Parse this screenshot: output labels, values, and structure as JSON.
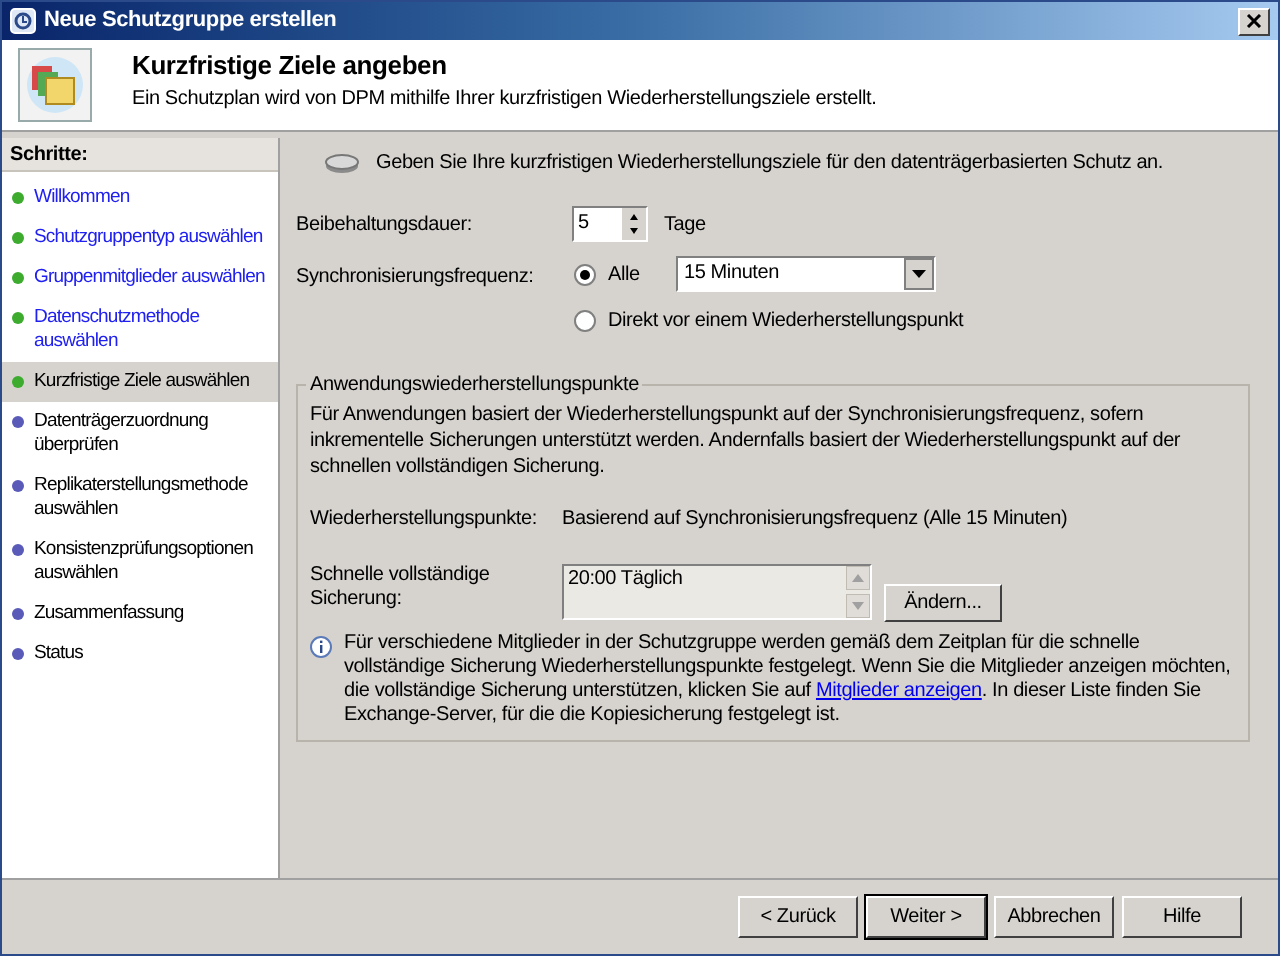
{
  "window": {
    "title": "Neue Schutzgruppe erstellen"
  },
  "header": {
    "title": "Kurzfristige Ziele angeben",
    "subtitle": "Ein Schutzplan wird von DPM mithilfe Ihrer kurzfristigen Wiederherstellungsziele erstellt."
  },
  "sidebar": {
    "heading": "Schritte:",
    "items": [
      {
        "label": "Willkommen",
        "completed": true,
        "selected": false
      },
      {
        "label": "Schutzgruppentyp auswählen",
        "completed": true,
        "selected": false
      },
      {
        "label": "Gruppenmitglieder auswählen",
        "completed": true,
        "selected": false
      },
      {
        "label": "Datenschutzmethode auswählen",
        "completed": true,
        "selected": false
      },
      {
        "label": "Kurzfristige Ziele auswählen",
        "completed": true,
        "selected": true
      },
      {
        "label": "Datenträgerzuordnung überprüfen",
        "completed": false,
        "selected": false
      },
      {
        "label": "Replikaterstellungsmethode auswählen",
        "completed": false,
        "selected": false
      },
      {
        "label": "Konsistenzprüfungsoptionen auswählen",
        "completed": false,
        "selected": false
      },
      {
        "label": "Zusammenfassung",
        "completed": false,
        "selected": false
      },
      {
        "label": "Status",
        "completed": false,
        "selected": false
      }
    ]
  },
  "intro": "Geben Sie Ihre kurzfristigen Wiederherstellungsziele für den datenträgerbasierten Schutz an.",
  "retention": {
    "label": "Beibehaltungsdauer:",
    "value": "5",
    "unit": "Tage"
  },
  "sync": {
    "label": "Synchronisierungsfrequenz:",
    "options": [
      {
        "label": "Alle",
        "selected": true,
        "dropdown": "15 Minuten"
      },
      {
        "label": "Direkt vor einem Wiederherstellungspunkt",
        "selected": false
      }
    ]
  },
  "group": {
    "title": "Anwendungswiederherstellungspunkte",
    "description": "Für Anwendungen basiert der Wiederherstellungspunkt auf der Synchronisierungsfrequenz, sofern inkrementelle Sicherungen unterstützt werden. Andernfalls basiert der Wiederherstellungspunkt auf der schnellen vollständigen Sicherung.",
    "points_label": "Wiederherstellungspunkte:",
    "points_value": "Basierend auf Synchronisierungsfrequenz (Alle 15 Minuten)",
    "full_backup_label": "Schnelle vollständige Sicherung:",
    "full_backup_value": "20:00 Täglich",
    "change_button": "Ändern...",
    "info_before": "Für verschiedene Mitglieder in der Schutzgruppe werden gemäß dem Zeitplan für die schnelle vollständige Sicherung Wiederherstellungspunkte festgelegt. Wenn Sie die Mitglieder anzeigen möchten, die vollständige Sicherung unterstützen, klicken Sie auf ",
    "info_link": "Mitglieder anzeigen",
    "info_after": ". In dieser Liste finden Sie Exchange-Server, für die die Kopiesicherung festgelegt ist."
  },
  "buttons": [
    {
      "label": "< Zurück",
      "default": false
    },
    {
      "label": "Weiter >",
      "default": true
    },
    {
      "label": "Abbrechen",
      "default": false
    },
    {
      "label": "Hilfe",
      "default": false
    }
  ]
}
